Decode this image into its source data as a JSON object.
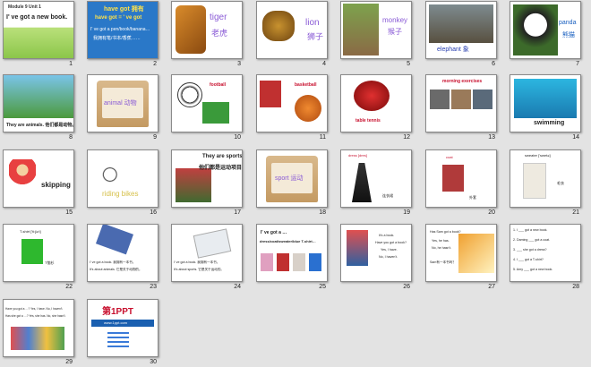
{
  "slides": [
    {
      "number": "1",
      "lines": [
        "Module 9 Unit 1",
        "I' ve got a new book."
      ]
    },
    {
      "number": "2",
      "lines": [
        "have got 拥有",
        "have got = ' ve got",
        "I' ve got a pen/book/banana…",
        "我拥有笔/书本/香蕉……"
      ]
    },
    {
      "number": "3",
      "lines": [
        "tiger",
        "老虎"
      ]
    },
    {
      "number": "4",
      "lines": [
        "lion",
        "狮子"
      ]
    },
    {
      "number": "5",
      "lines": [
        "monkey",
        "猴子"
      ]
    },
    {
      "number": "6",
      "lines": [
        "elephant 象"
      ]
    },
    {
      "number": "7",
      "lines": [
        "panda",
        "熊猫"
      ]
    },
    {
      "number": "8",
      "lines": [
        "They are animals. 他们都是动物。"
      ]
    },
    {
      "number": "9",
      "lines": [
        "animal 动物"
      ]
    },
    {
      "number": "10",
      "lines": [
        "football"
      ]
    },
    {
      "number": "11",
      "lines": [
        "basketball"
      ]
    },
    {
      "number": "12",
      "lines": [
        "table tennis"
      ]
    },
    {
      "number": "13",
      "lines": [
        "morning exercises"
      ]
    },
    {
      "number": "14",
      "lines": [
        "swimming"
      ]
    },
    {
      "number": "15",
      "lines": [
        "skipping"
      ]
    },
    {
      "number": "16",
      "lines": [
        "riding bikes"
      ]
    },
    {
      "number": "17",
      "lines": [
        "They are sports.",
        "他们都是运动项目。"
      ]
    },
    {
      "number": "18",
      "lines": [
        "sport 运动"
      ]
    },
    {
      "number": "19",
      "lines": [
        "dress [dres]",
        "连衣裙"
      ]
    },
    {
      "number": "20",
      "lines": [
        "coat",
        "外套"
      ]
    },
    {
      "number": "21",
      "lines": [
        "sweater ['swetə]",
        "毛衣"
      ]
    },
    {
      "number": "22",
      "lines": [
        "T-shirt ['ti:ʃə:t]",
        "T恤衫"
      ]
    },
    {
      "number": "23",
      "lines": [
        "I' ve got a book. 我拥有一本书。",
        "It's about animals. 它是关于动物的。"
      ]
    },
    {
      "number": "24",
      "lines": [
        "I' ve got a book. 我拥有一本书。",
        "It's about sports. 它是关于运动的。"
      ]
    },
    {
      "number": "25",
      "lines": [
        "I' ve got a …",
        "dress/coat/sweater/blue T-shirt…"
      ]
    },
    {
      "number": "26",
      "lines": [
        "It's a book.",
        "Have you got a book?",
        "Yes, I have.",
        "No, I haven't."
      ]
    },
    {
      "number": "27",
      "lines": [
        "Has Sam got a book?",
        "Yes, he has.",
        "No, he hasn't.",
        "Sam有一本书吗？"
      ]
    },
    {
      "number": "28",
      "lines": [
        "1. I ___ got a new book.",
        "2. Daming ___ got a coat.",
        "3. ___ she got a dress?",
        "4. I ___ got a T-shirt?",
        "5. Amy ___ got a new book."
      ]
    },
    {
      "number": "29",
      "lines": [
        "Have you got a …? Yes, I have. No, I haven't.",
        "Has she got a …? Yes, she has. No, she hasn't."
      ]
    },
    {
      "number": "30",
      "lines": [
        "第1PPT",
        "www.1ppt.com"
      ]
    }
  ],
  "colors": {
    "background": "#e3e3e3",
    "slide_bg": "#ffffff",
    "border": "#8a8a8a",
    "title_red": "#c8102e",
    "purple": "#8a5bd6"
  }
}
